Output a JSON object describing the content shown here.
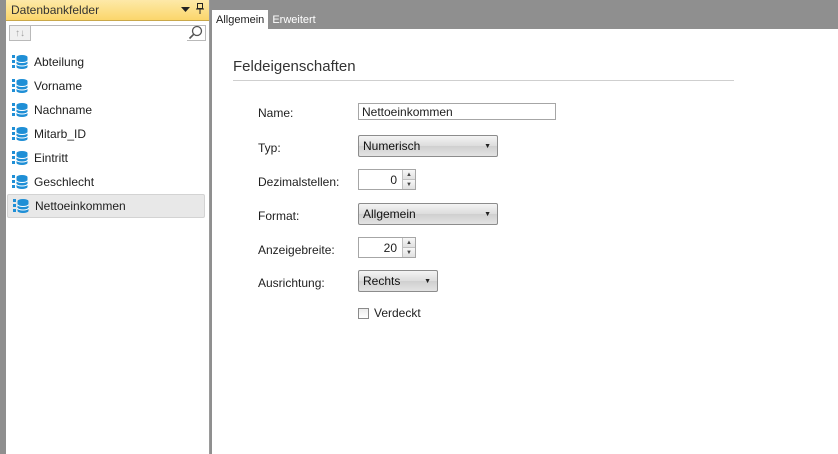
{
  "panel": {
    "title": "Datenbankfelder",
    "dropdown_glyph": "▾",
    "pin_glyph": "🖈",
    "sort_glyph": "↑↓",
    "search_value": ""
  },
  "fields": [
    {
      "label": "Abteilung",
      "selected": false
    },
    {
      "label": "Vorname",
      "selected": false
    },
    {
      "label": "Nachname",
      "selected": false
    },
    {
      "label": "Mitarb_ID",
      "selected": false
    },
    {
      "label": "Eintritt",
      "selected": false
    },
    {
      "label": "Geschlecht",
      "selected": false
    },
    {
      "label": "Nettoeinkommen",
      "selected": true
    }
  ],
  "tabs": [
    {
      "label": "Allgemein",
      "active": true
    },
    {
      "label": "Erweitert",
      "active": false
    }
  ],
  "section_title": "Feldeigenschaften",
  "form": {
    "name_label": "Name:",
    "name_value": "Nettoeinkommen",
    "typ_label": "Typ:",
    "typ_value": "Numerisch",
    "dezimal_label": "Dezimalstellen:",
    "dezimal_value": "0",
    "format_label": "Format:",
    "format_value": "Allgemein",
    "anzeige_label": "Anzeigebreite:",
    "anzeige_value": "20",
    "ausrichtung_label": "Ausrichtung:",
    "ausrichtung_value": "Rechts",
    "verdeckt_label": "Verdeckt",
    "verdeckt_checked": false
  },
  "colors": {
    "panel_header": "#fbd66b",
    "background": "#8f8f8f",
    "db_icon": "#1f8fd6"
  }
}
